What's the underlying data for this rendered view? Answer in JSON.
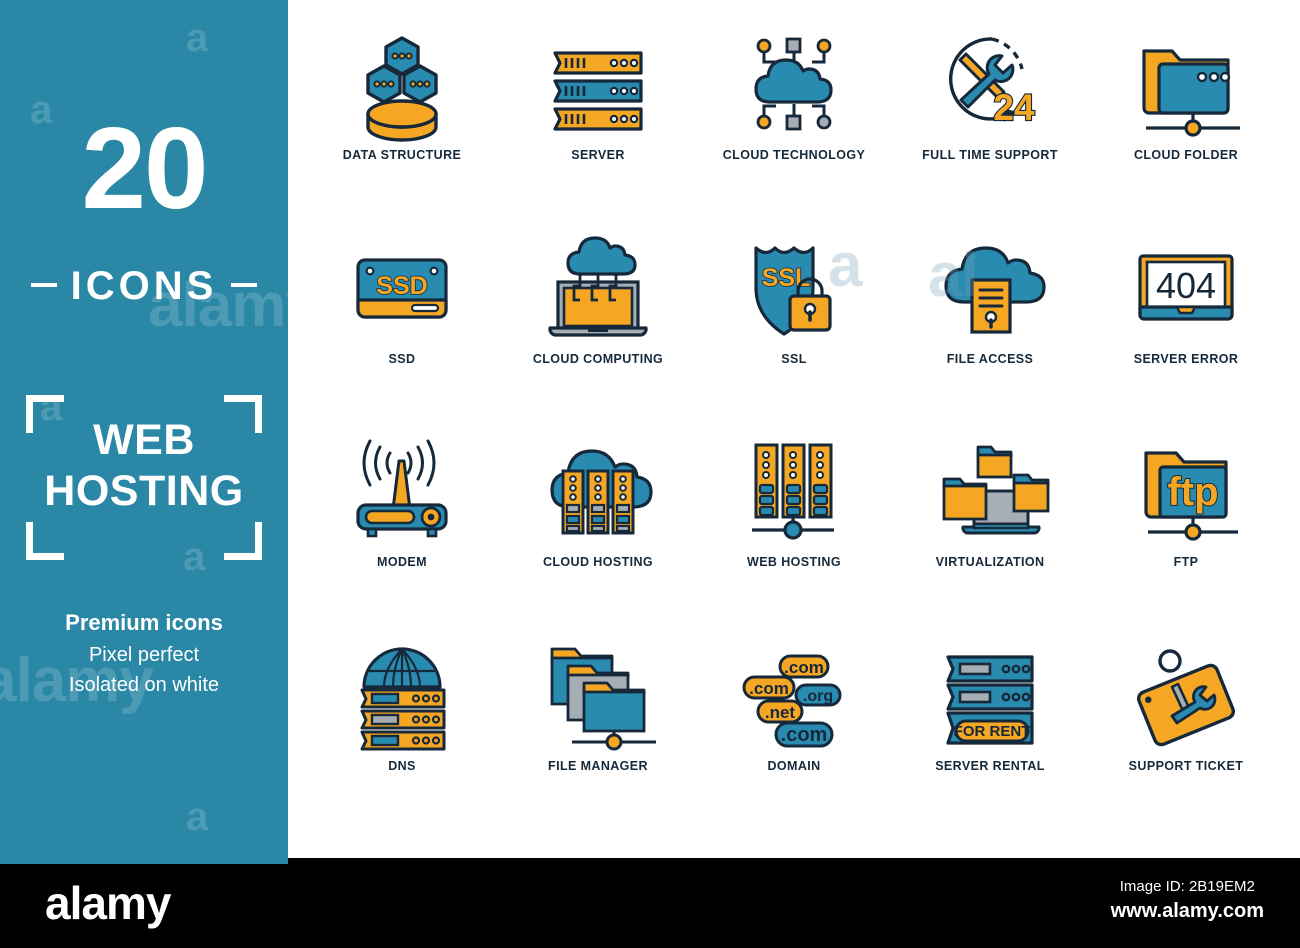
{
  "sidebar": {
    "count": "20",
    "icons_label": "ICONS",
    "title_line1": "WEB",
    "title_line2": "HOSTING",
    "tagline": [
      "Premium icons",
      "Pixel perfect",
      "Isolated on white"
    ],
    "watermark_letter": "a",
    "watermark_word": "alamy",
    "bg_color": "#2a87a6",
    "text_color": "#ffffff"
  },
  "palette": {
    "teal": "#2a8bb0",
    "orange": "#f5a623",
    "outline": "#16293b",
    "grey": "#a6adb4",
    "white": "#ffffff"
  },
  "grid": {
    "columns": 5,
    "rows": 4,
    "icons": [
      {
        "id": "data-structure",
        "label": "DATA STRUCTURE",
        "art": "data-structure"
      },
      {
        "id": "server",
        "label": "SERVER",
        "art": "server"
      },
      {
        "id": "cloud-technology",
        "label": "CLOUD TECHNOLOGY",
        "art": "cloud-technology"
      },
      {
        "id": "full-time-support",
        "label": "FULL TIME SUPPORT",
        "art": "full-time-support",
        "badge": "24"
      },
      {
        "id": "cloud-folder",
        "label": "CLOUD FOLDER",
        "art": "cloud-folder"
      },
      {
        "id": "ssd",
        "label": "SSD",
        "art": "ssd",
        "badge": "SSD"
      },
      {
        "id": "cloud-computing",
        "label": "CLOUD COMPUTING",
        "art": "cloud-computing"
      },
      {
        "id": "ssl",
        "label": "SSL",
        "art": "ssl",
        "badge": "SSL"
      },
      {
        "id": "file-access",
        "label": "FILE ACCESS",
        "art": "file-access"
      },
      {
        "id": "server-error",
        "label": "SERVER ERROR",
        "art": "server-error",
        "badge": "404"
      },
      {
        "id": "modem",
        "label": "MODEM",
        "art": "modem"
      },
      {
        "id": "cloud-hosting",
        "label": "CLOUD HOSTING",
        "art": "cloud-hosting"
      },
      {
        "id": "web-hosting",
        "label": "WEB HOSTING",
        "art": "web-hosting"
      },
      {
        "id": "virtualization",
        "label": "VIRTUALIZATION",
        "art": "virtualization"
      },
      {
        "id": "ftp",
        "label": "FTP",
        "art": "ftp",
        "badge": "ftp"
      },
      {
        "id": "dns",
        "label": "DNS",
        "art": "dns"
      },
      {
        "id": "file-manager",
        "label": "FILE MANAGER",
        "art": "file-manager"
      },
      {
        "id": "domain",
        "label": "DOMAIN",
        "art": "domain",
        "tags": [
          ".com",
          ".com",
          ".org",
          ".net",
          ".com"
        ]
      },
      {
        "id": "server-rental",
        "label": "SERVER RENTAL",
        "art": "server-rental",
        "badge": "FOR RENT"
      },
      {
        "id": "support-ticket",
        "label": "SUPPORT TICKET",
        "art": "support-ticket"
      }
    ]
  },
  "footer": {
    "logo": "alamy",
    "image_id": "Image ID: 2B19EM2",
    "url": "www.alamy.com"
  }
}
